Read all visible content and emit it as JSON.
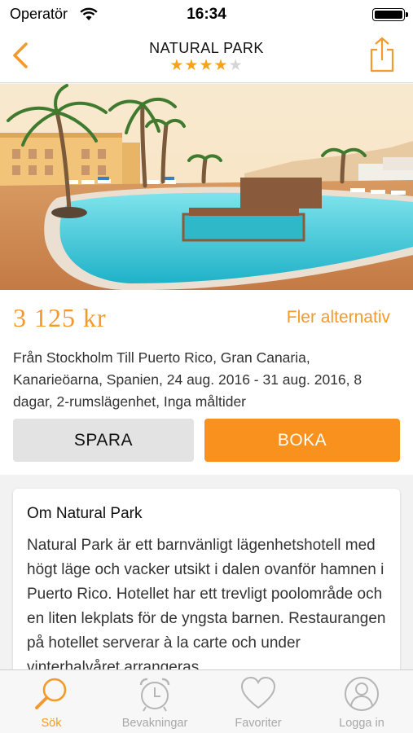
{
  "status_bar": {
    "carrier": "Operatör",
    "time": "16:34"
  },
  "header": {
    "title": "NATURAL PARK",
    "rating": 4,
    "rating_max": 5,
    "back_icon": "chevron-left-icon",
    "share_icon": "share-icon"
  },
  "offer": {
    "price": "3 125 kr",
    "more_options": "Fler alternativ",
    "details": "Från Stockholm Till Puerto Rico, Gran Canaria, Kanarieöarna, Spanien, 24 aug. 2016 - 31 aug. 2016, 8 dagar, 2-rumslägenhet, Inga måltider",
    "save_label": "SPARA",
    "book_label": "BOKA"
  },
  "about": {
    "title": "Om Natural Park",
    "text": "Natural Park är ett barnvänligt lägenhetshotell med högt läge och vacker utsikt i dalen ovanför hamnen i Puerto Rico. Hotellet har ett trevligt poolområde och en liten lekplats för de yngsta barnen. Restaurangen på hotellet serverar à la carte och under vinterhalvåret arrangeras"
  },
  "tabs": [
    {
      "label": "Sök",
      "icon": "search-icon",
      "active": true
    },
    {
      "label": "Bevakningar",
      "icon": "alarm-clock-icon",
      "active": false
    },
    {
      "label": "Favoriter",
      "icon": "heart-icon",
      "active": false
    },
    {
      "label": "Logga in",
      "icon": "user-icon",
      "active": false
    }
  ],
  "colors": {
    "accent": "#f39a2b",
    "book_button": "#f8911d",
    "star": "#f6a31a",
    "inactive_tab": "#a8a8a8"
  }
}
